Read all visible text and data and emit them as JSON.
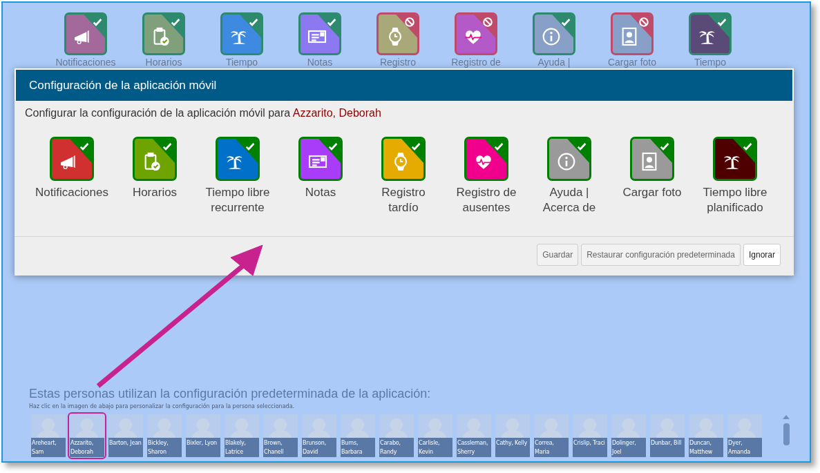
{
  "background_tiles": [
    {
      "label": "Notificaciones",
      "color": "#a3699a",
      "enabled": true
    },
    {
      "label": "Horarios",
      "color": "#7fa07a",
      "enabled": true
    },
    {
      "label": "Tiempo",
      "color": "#3d8ae0",
      "enabled": true
    },
    {
      "label": "Notas",
      "color": "#8c78f0",
      "enabled": true
    },
    {
      "label": "Registro",
      "color": "#a8a878",
      "enabled": false
    },
    {
      "label": "Registro de",
      "color": "#b45ac8",
      "enabled": false
    },
    {
      "label": "Ayuda |",
      "color": "#88a0c8",
      "enabled": true
    },
    {
      "label": "Cargar foto",
      "color": "#88a0c8",
      "enabled": false
    },
    {
      "label": "Tiempo",
      "color": "#5a4a78",
      "enabled": true
    }
  ],
  "dialog": {
    "title": "Configuración de la aplicación móvil",
    "intro": "Configurar la configuración de la aplicación móvil para",
    "person": "Azzarito, Deborah",
    "tiles": [
      {
        "label": "Notificaciones",
        "color": "#d03030",
        "enabled": true
      },
      {
        "label": "Horarios",
        "color": "#6fa300",
        "enabled": true
      },
      {
        "label": "Tiempo libre recurrente",
        "color": "#0070c8",
        "enabled": true
      },
      {
        "label": "Notas",
        "color": "#a83cf8",
        "enabled": true
      },
      {
        "label": "Registro tardío",
        "color": "#e6ab00",
        "enabled": true
      },
      {
        "label": "Registro de ausentes",
        "color": "#f0008c",
        "enabled": true
      },
      {
        "label": "Ayuda | Acerca de",
        "color": "#9a9a9a",
        "enabled": true
      },
      {
        "label": "Cargar foto",
        "color": "#9a9a9a",
        "enabled": true
      },
      {
        "label": "Tiempo libre planificado",
        "color": "#4e0000",
        "enabled": true
      }
    ],
    "buttons": [
      {
        "label": "Guardar",
        "disabled": true
      },
      {
        "label": "Restaurar configuración predeterminada",
        "disabled": true
      },
      {
        "label": "Ignorar",
        "disabled": false
      }
    ]
  },
  "people_section": {
    "heading": "Estas personas utilizan la configuración predeterminada de la aplicación:",
    "hint": "Haz clic en la imagen de abajo para personalizar la configuración para la persona seleccionada.",
    "people": [
      {
        "name": "Areheart, Sam",
        "selected": false
      },
      {
        "name": "Azzarito, Deborah",
        "selected": true
      },
      {
        "name": "Barton, Jean",
        "selected": false
      },
      {
        "name": "Bickley, Sharon",
        "selected": false
      },
      {
        "name": "Bixler, Lyon",
        "selected": false
      },
      {
        "name": "Blakely, Latrice",
        "selected": false
      },
      {
        "name": "Brown, Chanell",
        "selected": false
      },
      {
        "name": "Brunson, David",
        "selected": false
      },
      {
        "name": "Burns, Barbara",
        "selected": false
      },
      {
        "name": "Carabo, Randy",
        "selected": false
      },
      {
        "name": "Carlisle, Kevin",
        "selected": false
      },
      {
        "name": "Cassleman, Sherry",
        "selected": false
      },
      {
        "name": "Cathy, Kelly",
        "selected": false
      },
      {
        "name": "Correa, Maria",
        "selected": false
      },
      {
        "name": "Crislip, Traci",
        "selected": false
      },
      {
        "name": "Dolinger, Joel",
        "selected": false
      },
      {
        "name": "Dunbar, Bill",
        "selected": false
      },
      {
        "name": "Duncan, Matthew",
        "selected": false
      },
      {
        "name": "Dyer, Amanda",
        "selected": false
      }
    ]
  }
}
